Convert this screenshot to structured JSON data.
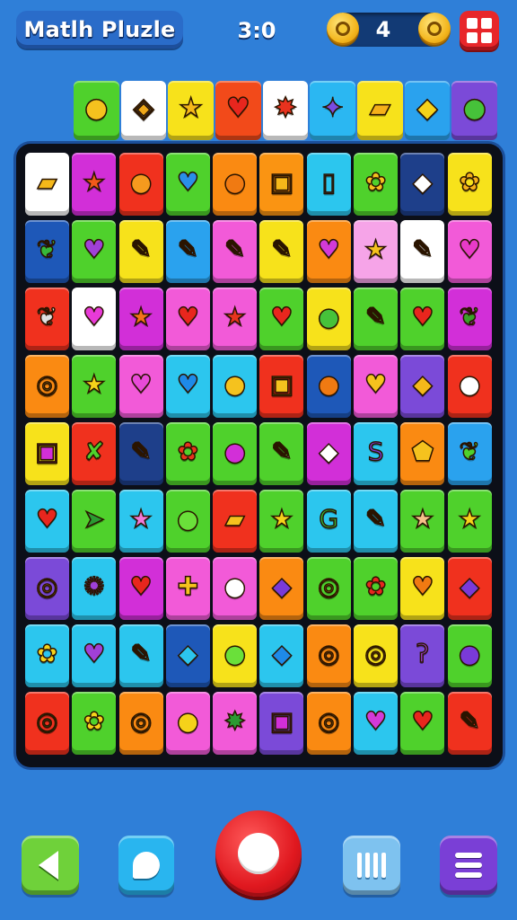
{
  "header": {
    "title": "Matlh Pluzle",
    "timer": "3:0",
    "score": "4"
  },
  "icons": {
    "coin_left": "coin-icon",
    "coin_right": "coin-icon",
    "grid_button": "grid-menu-icon"
  },
  "colors": {
    "background": "#2f7fd8",
    "board": "#0c0f18",
    "accent_red": "#e8262a",
    "coin_gold": "#f3b51c"
  },
  "next_row": [
    {
      "bg": "#4fd12c",
      "glyph": "●",
      "fg": "#f5c21e",
      "icon": "lemon-icon"
    },
    {
      "bg": "#ffffff",
      "glyph": "◈",
      "fg": "#f0a818",
      "icon": "cheese-icon"
    },
    {
      "bg": "#f7e21b",
      "glyph": "★",
      "fg": "#f5b81a",
      "icon": "star-icon"
    },
    {
      "bg": "#f24a1a",
      "glyph": "♥",
      "fg": "#e8261e",
      "icon": "apple-icon"
    },
    {
      "bg": "#ffffff",
      "glyph": "✸",
      "fg": "#e8321e",
      "icon": "splat-icon"
    },
    {
      "bg": "#2bb7f2",
      "glyph": "✦",
      "fg": "#7a4be0",
      "icon": "spark-icon"
    },
    {
      "bg": "#f7e21b",
      "glyph": "▰",
      "fg": "#f5b01a",
      "icon": "popsicle-icon"
    },
    {
      "bg": "#2aa2ee",
      "glyph": "◆",
      "fg": "#f5d21a",
      "icon": "bell-icon"
    },
    {
      "bg": "#7b4ad8",
      "glyph": "●",
      "fg": "#46c23a",
      "icon": "apple-icon"
    }
  ],
  "board": [
    [
      {
        "bg": "#ffffff",
        "glyph": "▰",
        "fg": "#f5b81a",
        "icon": "candy-bar-icon"
      },
      {
        "bg": "#d22fd8",
        "glyph": "★",
        "fg": "#f25a1a",
        "icon": "star-icon"
      },
      {
        "bg": "#f0311e",
        "glyph": "●",
        "fg": "#f59a1e",
        "icon": "orange-icon"
      },
      {
        "bg": "#4fd12c",
        "glyph": "♥",
        "fg": "#2a8fe8",
        "icon": "heart-icon"
      },
      {
        "bg": "#fa8a12",
        "glyph": "●",
        "fg": "#f07a12",
        "icon": "orange-icon"
      },
      {
        "bg": "#fa9412",
        "glyph": "▣",
        "fg": "#f5b81a",
        "icon": "square-icon"
      },
      {
        "bg": "#2cc6ee",
        "glyph": "▯",
        "fg": "#1a78c8",
        "icon": "phone-icon"
      },
      {
        "bg": "#4fd12c",
        "glyph": "✿",
        "fg": "#f5c21e",
        "icon": "lollipop-icon"
      },
      {
        "bg": "#1e3f8a",
        "glyph": "◆",
        "fg": "#ffffff",
        "icon": "eraser-icon"
      },
      {
        "bg": "#f7e21b",
        "glyph": "✿",
        "fg": "#f5b01a",
        "icon": "flower-icon"
      }
    ],
    [
      {
        "bg": "#1e58b8",
        "glyph": "❦",
        "fg": "#36b83a",
        "icon": "leaf-icon"
      },
      {
        "bg": "#4fd12c",
        "glyph": "♥",
        "fg": "#a040d8",
        "icon": "heart-icon"
      },
      {
        "bg": "#f7e21b",
        "glyph": "✎",
        "fg": "#e8341e",
        "icon": "brush-icon"
      },
      {
        "bg": "#2aa2ee",
        "glyph": "✎",
        "fg": "#1e60c8",
        "icon": "pen-icon"
      },
      {
        "bg": "#f25ad8",
        "glyph": "✎",
        "fg": "#3ac27a",
        "icon": "crayon-icon"
      },
      {
        "bg": "#f7e21b",
        "glyph": "✎",
        "fg": "#c8c8c8",
        "icon": "pencil-icon"
      },
      {
        "bg": "#fa8a12",
        "glyph": "♥",
        "fg": "#d23ad8",
        "icon": "heart-icon"
      },
      {
        "bg": "#f6a4e8",
        "glyph": "★",
        "fg": "#f5c21e",
        "icon": "star-icon"
      },
      {
        "bg": "#ffffff",
        "glyph": "✎",
        "fg": "#3ab86a",
        "icon": "marker-icon"
      },
      {
        "bg": "#f25ad8",
        "glyph": "♥",
        "fg": "#e83ac8",
        "icon": "heart-icon"
      }
    ],
    [
      {
        "bg": "#f0311e",
        "glyph": "❦",
        "fg": "#e0e0e0",
        "icon": "feather-icon"
      },
      {
        "bg": "#ffffff",
        "glyph": "♥",
        "fg": "#e83ad8",
        "icon": "heart-icon"
      },
      {
        "bg": "#d22fd8",
        "glyph": "★",
        "fg": "#f5721a",
        "icon": "star-icon"
      },
      {
        "bg": "#f25ad8",
        "glyph": "♥",
        "fg": "#e8261e",
        "icon": "heart-icon"
      },
      {
        "bg": "#f25ad8",
        "glyph": "★",
        "fg": "#e8341e",
        "icon": "star-icon"
      },
      {
        "bg": "#4fd12c",
        "glyph": "♥",
        "fg": "#e8261e",
        "icon": "heart-icon"
      },
      {
        "bg": "#f7e21b",
        "glyph": "●",
        "fg": "#46c23a",
        "icon": "grape-icon"
      },
      {
        "bg": "#4fd12c",
        "glyph": "✎",
        "fg": "#2a9a32",
        "icon": "crayon-icon"
      },
      {
        "bg": "#4fd12c",
        "glyph": "♥",
        "fg": "#e8261e",
        "icon": "heart-icon"
      },
      {
        "bg": "#d22fd8",
        "glyph": "❦",
        "fg": "#3aa02a",
        "icon": "leaf-icon"
      }
    ],
    [
      {
        "bg": "#fa8a12",
        "glyph": "◎",
        "fg": "#f5c21e",
        "icon": "donut-icon"
      },
      {
        "bg": "#4fd12c",
        "glyph": "★",
        "fg": "#f5d21a",
        "icon": "star-icon"
      },
      {
        "bg": "#f25ad8",
        "glyph": "♥",
        "fg": "#e84ad8",
        "icon": "heart-icon"
      },
      {
        "bg": "#2cc6ee",
        "glyph": "♥",
        "fg": "#1e8ae8",
        "icon": "heart-icon"
      },
      {
        "bg": "#2cc6ee",
        "glyph": "●",
        "fg": "#f5c21e",
        "icon": "lemon-icon"
      },
      {
        "bg": "#f0311e",
        "glyph": "▣",
        "fg": "#f5c21e",
        "icon": "crown-icon"
      },
      {
        "bg": "#1e58b8",
        "glyph": "●",
        "fg": "#f07a12",
        "icon": "bean-icon"
      },
      {
        "bg": "#f25ad8",
        "glyph": "♥",
        "fg": "#f5c21e",
        "icon": "hand-icon"
      },
      {
        "bg": "#7b4ad8",
        "glyph": "◆",
        "fg": "#f5b81a",
        "icon": "drop-icon"
      },
      {
        "bg": "#f0311e",
        "glyph": "●",
        "fg": "#ffffff",
        "icon": "face-icon"
      }
    ],
    [
      {
        "bg": "#f7e21b",
        "glyph": "▣",
        "fg": "#d22fd8",
        "icon": "square-icon"
      },
      {
        "bg": "#f0311e",
        "glyph": "✘",
        "fg": "#4fd12c",
        "icon": "cross-icon"
      },
      {
        "bg": "#1e3f8a",
        "glyph": "✎",
        "fg": "#ffffff",
        "icon": "pencil-icon"
      },
      {
        "bg": "#4fd12c",
        "glyph": "✿",
        "fg": "#e8341e",
        "icon": "flower-icon"
      },
      {
        "bg": "#4fd12c",
        "glyph": "●",
        "fg": "#d22fd8",
        "icon": "balloon-icon"
      },
      {
        "bg": "#4fd12c",
        "glyph": "✎",
        "fg": "#e0e0e0",
        "icon": "pencil-icon"
      },
      {
        "bg": "#d22fd8",
        "glyph": "◆",
        "fg": "#ffffff",
        "icon": "box-icon"
      },
      {
        "bg": "#2cc6ee",
        "glyph": "S",
        "fg": "#7a3ad8",
        "icon": "letter-s-icon"
      },
      {
        "bg": "#fa8a12",
        "glyph": "⬟",
        "fg": "#f5c21e",
        "icon": "pentagon-icon"
      },
      {
        "bg": "#2aa2ee",
        "glyph": "❦",
        "fg": "#4fd12c",
        "icon": "leaf-icon"
      }
    ],
    [
      {
        "bg": "#2cc6ee",
        "glyph": "♥",
        "fg": "#e8261e",
        "icon": "heart-icon"
      },
      {
        "bg": "#4fd12c",
        "glyph": "➤",
        "fg": "#2a9a32",
        "icon": "arrow-icon"
      },
      {
        "bg": "#2cc6ee",
        "glyph": "★",
        "fg": "#f07ad8",
        "icon": "star-icon"
      },
      {
        "bg": "#4fd12c",
        "glyph": "●",
        "fg": "#6ae03a",
        "icon": "apple-icon"
      },
      {
        "bg": "#f0311e",
        "glyph": "▰",
        "fg": "#f5c21e",
        "icon": "ticket-icon"
      },
      {
        "bg": "#4fd12c",
        "glyph": "★",
        "fg": "#f5d21a",
        "icon": "star-icon"
      },
      {
        "bg": "#2cc6ee",
        "glyph": "G",
        "fg": "#36b83a",
        "icon": "letter-g-icon"
      },
      {
        "bg": "#2cc6ee",
        "glyph": "✎",
        "fg": "#e84a8a",
        "icon": "ice-cream-icon"
      },
      {
        "bg": "#4fd12c",
        "glyph": "★",
        "fg": "#f7c08a",
        "icon": "star-icon"
      },
      {
        "bg": "#4fd12c",
        "glyph": "★",
        "fg": "#f5d21a",
        "icon": "star-icon"
      }
    ],
    [
      {
        "bg": "#7b4ad8",
        "glyph": "◎",
        "fg": "#f5a81a",
        "icon": "fruit-icon"
      },
      {
        "bg": "#2cc6ee",
        "glyph": "✺",
        "fg": "#a040d8",
        "icon": "grape-icon"
      },
      {
        "bg": "#d22fd8",
        "glyph": "♥",
        "fg": "#e8261e",
        "icon": "heart-icon"
      },
      {
        "bg": "#f25ad8",
        "glyph": "✚",
        "fg": "#f5c21e",
        "icon": "puzzle-icon"
      },
      {
        "bg": "#f25ad8",
        "glyph": "●",
        "fg": "#ffffff",
        "icon": "egg-icon"
      },
      {
        "bg": "#fa8a12",
        "glyph": "◆",
        "fg": "#7a3ad8",
        "icon": "balloon-icon"
      },
      {
        "bg": "#4fd12c",
        "glyph": "◎",
        "fg": "#f5d21a",
        "icon": "ring-icon"
      },
      {
        "bg": "#4fd12c",
        "glyph": "✿",
        "fg": "#e8261e",
        "icon": "flower-icon"
      },
      {
        "bg": "#f7e21b",
        "glyph": "♥",
        "fg": "#f07a12",
        "icon": "heart-icon"
      },
      {
        "bg": "#f0311e",
        "glyph": "◆",
        "fg": "#7a3ad8",
        "icon": "plum-icon"
      }
    ],
    [
      {
        "bg": "#2cc6ee",
        "glyph": "✿",
        "fg": "#f5d21a",
        "icon": "teapot-icon"
      },
      {
        "bg": "#2cc6ee",
        "glyph": "♥",
        "fg": "#a040d8",
        "icon": "heart-icon"
      },
      {
        "bg": "#2cc6ee",
        "glyph": "✎",
        "fg": "#3ab86a",
        "icon": "crayon-icon"
      },
      {
        "bg": "#1e58b8",
        "glyph": "◆",
        "fg": "#2cc6ee",
        "icon": "drop-icon"
      },
      {
        "bg": "#f7e21b",
        "glyph": "●",
        "fg": "#6ae03a",
        "icon": "apple-icon"
      },
      {
        "bg": "#2cc6ee",
        "glyph": "◆",
        "fg": "#1e8ae8",
        "icon": "balloon-icon"
      },
      {
        "bg": "#fa8a12",
        "glyph": "◎",
        "fg": "#f07a12",
        "icon": "swirl-icon"
      },
      {
        "bg": "#f7e21b",
        "glyph": "◎",
        "fg": "#f5a81a",
        "icon": "swirl-icon"
      },
      {
        "bg": "#7b4ad8",
        "glyph": "ʔ",
        "fg": "#a040d8",
        "icon": "hook-icon"
      },
      {
        "bg": "#4fd12c",
        "glyph": "●",
        "fg": "#7a3ad8",
        "icon": "plum-icon"
      }
    ],
    [
      {
        "bg": "#f0311e",
        "glyph": "◎",
        "fg": "#2a9a32",
        "icon": "ring-icon"
      },
      {
        "bg": "#4fd12c",
        "glyph": "✿",
        "fg": "#f5d21a",
        "icon": "flower-icon"
      },
      {
        "bg": "#fa8a12",
        "glyph": "◎",
        "fg": "#f5c21e",
        "icon": "donut-icon"
      },
      {
        "bg": "#f25ad8",
        "glyph": "●",
        "fg": "#f5d21a",
        "icon": "lemon-icon"
      },
      {
        "bg": "#f25ad8",
        "glyph": "✸",
        "fg": "#2a9a32",
        "icon": "splat-icon"
      },
      {
        "bg": "#7b4ad8",
        "glyph": "▣",
        "fg": "#d22fd8",
        "icon": "spiral-icon"
      },
      {
        "bg": "#fa8a12",
        "glyph": "◎",
        "fg": "#f5a81a",
        "icon": "donut-icon"
      },
      {
        "bg": "#2cc6ee",
        "glyph": "♥",
        "fg": "#d23ad8",
        "icon": "heart-icon"
      },
      {
        "bg": "#4fd12c",
        "glyph": "♥",
        "fg": "#e8261e",
        "icon": "heart-icon"
      },
      {
        "bg": "#f0311e",
        "glyph": "✎",
        "fg": "#e0e0e0",
        "icon": "pencil-icon"
      }
    ]
  ],
  "controls": {
    "back": "back-arrow-icon",
    "chat": "chat-bubble-icon",
    "main": "main-action-icon",
    "pause": "pause-bars-icon",
    "menu": "hamburger-menu-icon"
  }
}
